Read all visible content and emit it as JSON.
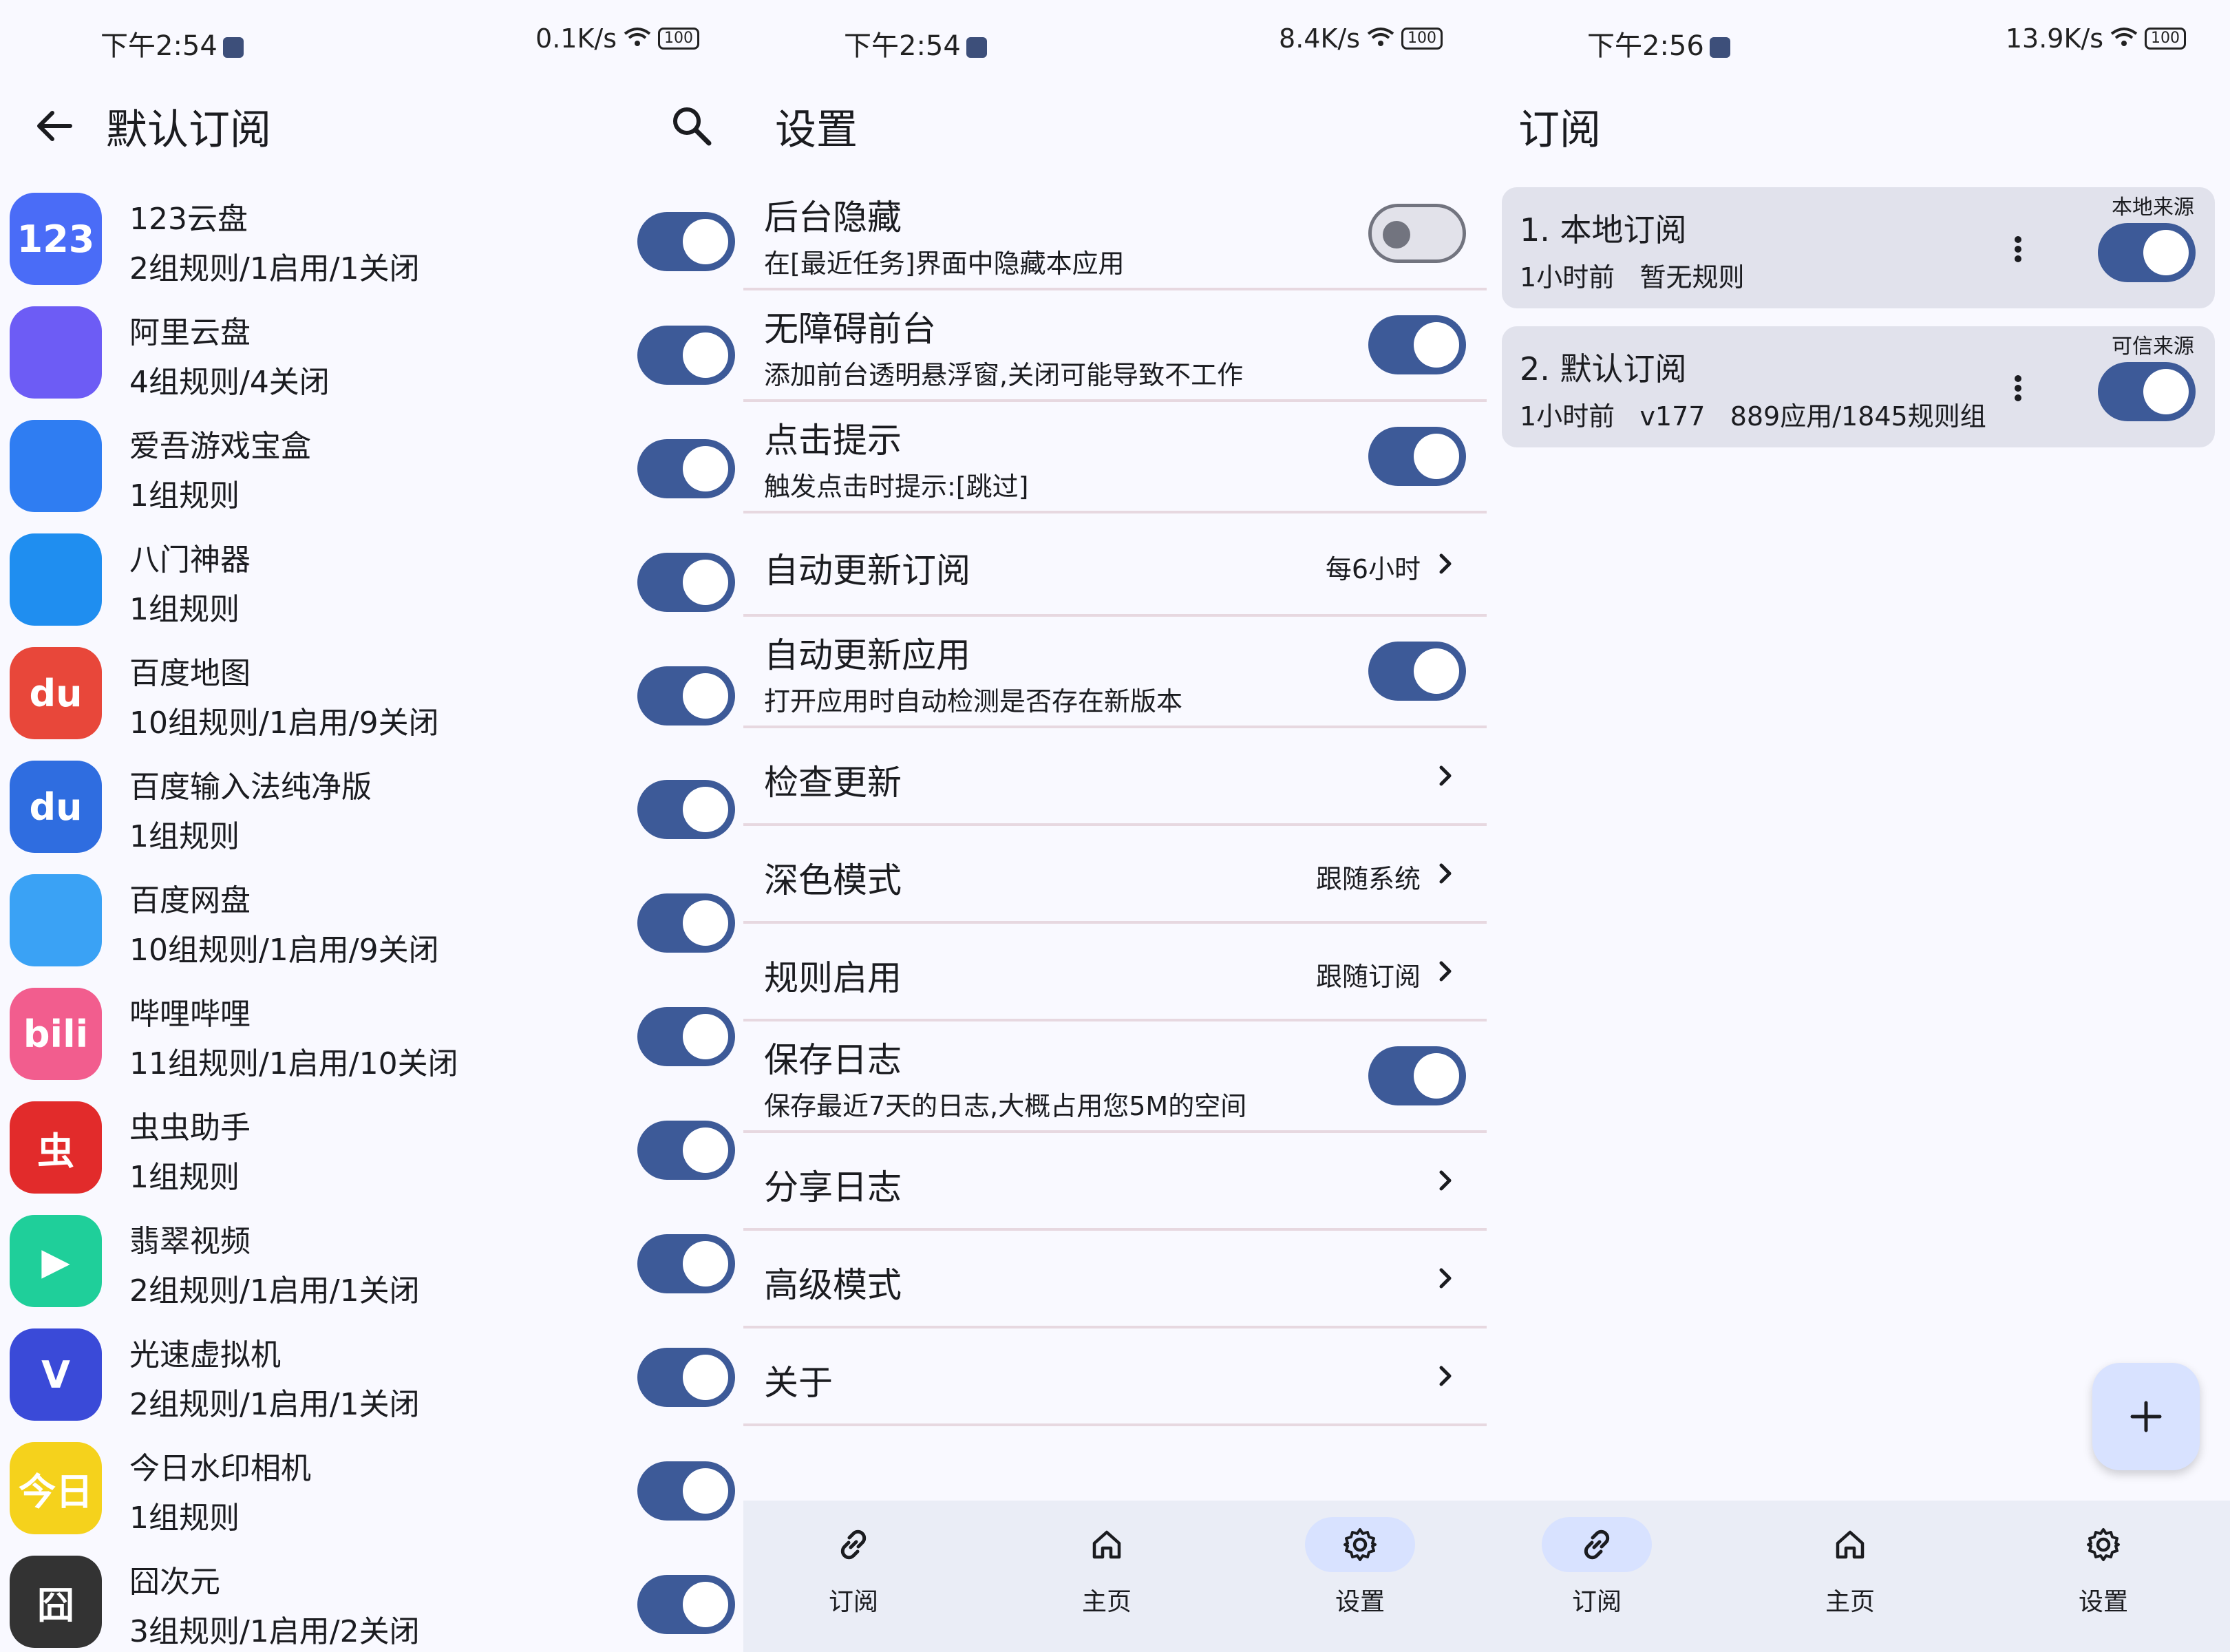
{
  "panels": [
    {
      "status": {
        "time": "下午2:54",
        "speed": "0.1K/s",
        "battery": "100"
      },
      "title": "默认订阅",
      "apps": [
        {
          "name": "123云盘",
          "desc": "2组规则/1启用/1关闭",
          "icon_text": "123",
          "color": "#4a6cf7"
        },
        {
          "name": "阿里云盘",
          "desc": "4组规则/4关闭",
          "icon_text": "",
          "color": "#6d5cf5"
        },
        {
          "name": "爱吾游戏宝盒",
          "desc": "1组规则",
          "icon_text": "",
          "color": "#2f7df2"
        },
        {
          "name": "八门神器",
          "desc": "1组规则",
          "icon_text": "",
          "color": "#1f8ef0"
        },
        {
          "name": "百度地图",
          "desc": "10组规则/1启用/9关闭",
          "icon_text": "du",
          "color": "#e8473a"
        },
        {
          "name": "百度输入法纯净版",
          "desc": "1组规则",
          "icon_text": "du",
          "color": "#2f6de0"
        },
        {
          "name": "百度网盘",
          "desc": "10组规则/1启用/9关闭",
          "icon_text": "",
          "color": "#3aa2f5"
        },
        {
          "name": "哔哩哔哩",
          "desc": "11组规则/1启用/10关闭",
          "icon_text": "bili",
          "color": "#f25d8e"
        },
        {
          "name": "虫虫助手",
          "desc": "1组规则",
          "icon_text": "虫",
          "color": "#e22b2b"
        },
        {
          "name": "翡翠视频",
          "desc": "2组规则/1启用/1关闭",
          "icon_text": "▶",
          "color": "#1fcf9a"
        },
        {
          "name": "光速虚拟机",
          "desc": "2组规则/1启用/1关闭",
          "icon_text": "V",
          "color": "#3a4ad8"
        },
        {
          "name": "今日水印相机",
          "desc": "1组规则",
          "icon_text": "今日",
          "color": "#f5d21c"
        },
        {
          "name": "囧次元",
          "desc": "3组规则/1启用/2关闭",
          "icon_text": "囧",
          "color": "#333333"
        }
      ]
    },
    {
      "status": {
        "time": "下午2:54",
        "speed": "8.4K/s",
        "battery": "100"
      },
      "title": "设置",
      "settings": [
        {
          "title": "后台隐藏",
          "sub": "在[最近任务]界面中隐藏本应用",
          "toggle": "off"
        },
        {
          "title": "无障碍前台",
          "sub": "添加前台透明悬浮窗,关闭可能导致不工作",
          "toggle": "on"
        },
        {
          "title": "点击提示",
          "sub": "触发点击时提示:[跳过]",
          "toggle": "on"
        },
        {
          "title": "自动更新订阅",
          "value": "每6小时"
        },
        {
          "title": "自动更新应用",
          "sub": "打开应用时自动检测是否存在新版本",
          "toggle": "on"
        },
        {
          "title": "检查更新"
        },
        {
          "title": "深色模式",
          "value": "跟随系统"
        },
        {
          "title": "规则启用",
          "value": "跟随订阅"
        },
        {
          "title": "保存日志",
          "sub": "保存最近7天的日志,大概占用您5M的空间",
          "toggle": "on"
        },
        {
          "title": "分享日志"
        },
        {
          "title": "高级模式"
        },
        {
          "title": "关于"
        }
      ],
      "nav": [
        {
          "label": "订阅",
          "icon": "link-icon"
        },
        {
          "label": "主页",
          "icon": "home-icon"
        },
        {
          "label": "设置",
          "icon": "gear-icon",
          "active": true
        }
      ]
    },
    {
      "status": {
        "time": "下午2:56",
        "speed": "13.9K/s",
        "battery": "100"
      },
      "title": "订阅",
      "subscriptions": [
        {
          "title": "1. 本地订阅",
          "time": "1小时前",
          "info": "暂无规则",
          "source": "本地来源",
          "enabled": true
        },
        {
          "title": "2. 默认订阅",
          "time": "1小时前",
          "info": "v177   889应用/1845规则组",
          "source": "可信来源",
          "enabled": true
        }
      ],
      "nav": [
        {
          "label": "订阅",
          "icon": "link-icon",
          "active": true
        },
        {
          "label": "主页",
          "icon": "home-icon"
        },
        {
          "label": "设置",
          "icon": "gear-icon"
        }
      ]
    }
  ]
}
